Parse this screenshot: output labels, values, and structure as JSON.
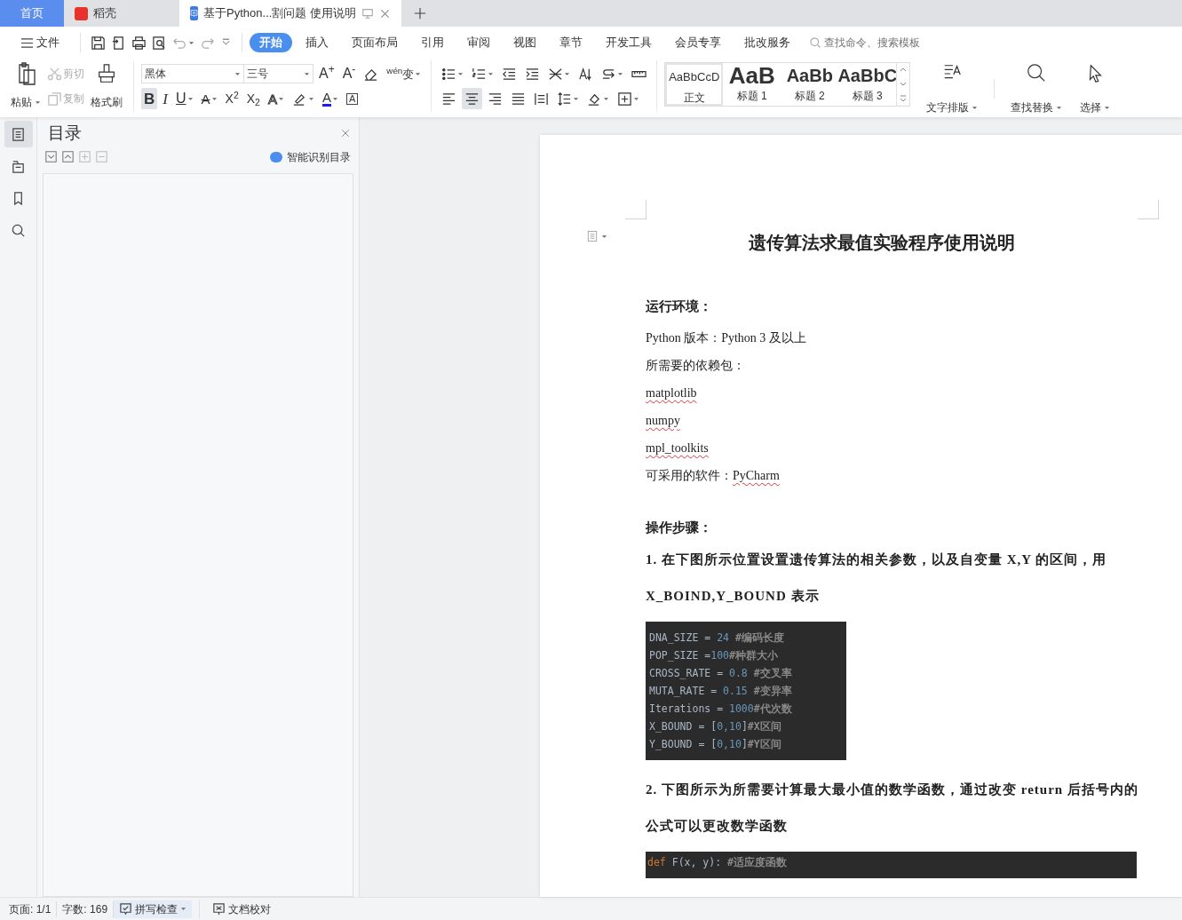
{
  "tabs": [
    {
      "label": "首页",
      "kind": "home",
      "selected": false
    },
    {
      "label": "稻壳",
      "kind": "app",
      "selected": false
    },
    {
      "label": "基于Python...割问题 使用说明",
      "kind": "doc",
      "selected": true
    }
  ],
  "menu": {
    "file": "文件",
    "ribbon_tabs": [
      {
        "label": "开始",
        "selected": true
      },
      {
        "label": "插入",
        "selected": false
      },
      {
        "label": "页面布局",
        "selected": false
      },
      {
        "label": "引用",
        "selected": false
      },
      {
        "label": "审阅",
        "selected": false
      },
      {
        "label": "视图",
        "selected": false
      },
      {
        "label": "章节",
        "selected": false
      },
      {
        "label": "开发工具",
        "selected": false
      },
      {
        "label": "会员专享",
        "selected": false
      },
      {
        "label": "批改服务",
        "selected": false
      }
    ],
    "search": {
      "placeholder": "查找命令、搜索模板"
    }
  },
  "clipboard": {
    "paste": "粘贴",
    "cut": {
      "label": "剪切",
      "disabled": true
    },
    "copy": {
      "label": "复制",
      "disabled": true
    },
    "format_painter": "格式刷"
  },
  "font": {
    "name": "黑体",
    "size": "三号",
    "row1": [
      {
        "kind": "grow",
        "glyph": "A$^{+}$",
        "selected": false
      },
      {
        "kind": "shrink",
        "glyph": "A$^{-}$",
        "selected": false
      },
      {
        "kind": "clear",
        "selected": false
      },
      {
        "kind": "phonetic",
        "glyph": "$^{wén}$变",
        "selected": false
      }
    ],
    "row2": [
      {
        "kind": "bold",
        "glyph": "B",
        "selected": true
      },
      {
        "kind": "italic",
        "glyph": "I",
        "selected": false
      },
      {
        "kind": "underline",
        "glyph": "U",
        "selected": false
      },
      {
        "kind": "strike",
        "glyph": "A",
        "selected": false
      },
      {
        "kind": "sup",
        "glyph": "X$^{2}$",
        "selected": false
      },
      {
        "kind": "sub",
        "glyph": "X$_{2}$",
        "selected": false
      },
      {
        "kind": "effect",
        "glyph": "A",
        "selected": false
      },
      {
        "kind": "highlight",
        "selected": false
      },
      {
        "kind": "color",
        "glyph": "A",
        "selected": false
      },
      {
        "kind": "boxed",
        "glyph": "A",
        "selected": false
      }
    ]
  },
  "paragraph": {
    "row1": [
      {
        "kind": "bullets",
        "selected": false
      },
      {
        "kind": "numbering",
        "selected": false
      },
      {
        "kind": "outdent",
        "selected": false
      },
      {
        "kind": "indent",
        "selected": false
      },
      {
        "kind": "layout",
        "selected": false
      },
      {
        "kind": "sort",
        "selected": false
      },
      {
        "kind": "breaks",
        "selected": false
      },
      {
        "kind": "ruler",
        "selected": false
      }
    ],
    "row2": [
      {
        "kind": "left",
        "selected": false
      },
      {
        "kind": "center",
        "selected": true
      },
      {
        "kind": "right",
        "selected": false
      },
      {
        "kind": "justify",
        "selected": false
      },
      {
        "kind": "distribute",
        "selected": false
      },
      {
        "kind": "spacing",
        "selected": false
      },
      {
        "kind": "shading",
        "selected": false
      },
      {
        "kind": "borders",
        "selected": false
      }
    ]
  },
  "styles": [
    {
      "preview": "AaBbCcD",
      "label": "正文",
      "kind": "normal",
      "selected": true
    },
    {
      "preview": "AaB",
      "label": "标题 1",
      "kind": "h1",
      "selected": false
    },
    {
      "preview": "AaBb",
      "label": "标题 2",
      "kind": "h2",
      "selected": false
    },
    {
      "preview": "AaBbC",
      "label": "标题 3",
      "kind": "h3",
      "selected": false
    }
  ],
  "tools": [
    {
      "label": "文字排版",
      "kind": "layout"
    },
    {
      "label": "查找替换",
      "kind": "find"
    },
    {
      "label": "选择",
      "kind": "select"
    }
  ],
  "sidebar": {
    "items": [
      {
        "kind": "toc",
        "selected": true
      },
      {
        "kind": "chapters",
        "selected": false
      },
      {
        "kind": "bookmark",
        "selected": false
      },
      {
        "kind": "search",
        "selected": false
      }
    ]
  },
  "toc": {
    "title": "目录",
    "smart": "智能识别目录",
    "buttons": [
      {
        "kind": "expand",
        "disabled": false
      },
      {
        "kind": "collapse",
        "disabled": false
      },
      {
        "kind": "add",
        "disabled": true
      },
      {
        "kind": "remove",
        "disabled": true
      }
    ]
  },
  "document": {
    "title": "遗传算法求最值实验程序使用说明",
    "blocks": [
      {
        "kind": "heading",
        "text": "运行环境："
      },
      {
        "kind": "text",
        "text": "Python 版本：Python 3 及以上"
      },
      {
        "kind": "text",
        "text": "所需要的依赖包："
      },
      {
        "kind": "text",
        "flagged": "matplotlib"
      },
      {
        "kind": "text",
        "flagged": "numpy"
      },
      {
        "kind": "text",
        "flagged": "mpl_toolkits"
      },
      {
        "kind": "text",
        "text": "可采用的软件：",
        "flagged": "PyCharm"
      },
      {
        "kind": "gap"
      },
      {
        "kind": "heading",
        "text": "操作步骤："
      },
      {
        "kind": "step",
        "text": "1.  在下图所示位置设置遗传算法的相关参数，以及自变量 X,Y 的区间，用"
      },
      {
        "kind": "step",
        "text": "X_BOIND,Y_BOUND 表示"
      },
      {
        "kind": "code",
        "lines": [
          [
            {
              "kind": "plain",
              "text": "DNA_SIZE = "
            },
            {
              "kind": "number",
              "text": "24"
            },
            {
              "kind": "comment",
              "text": " #编码长度"
            }
          ],
          [
            {
              "kind": "plain",
              "text": "POP_SIZE ="
            },
            {
              "kind": "number",
              "text": "100"
            },
            {
              "kind": "comment",
              "text": "#种群大小"
            }
          ],
          [
            {
              "kind": "plain",
              "text": "CROSS_RATE = "
            },
            {
              "kind": "number",
              "text": "0.8"
            },
            {
              "kind": "comment",
              "text": " #交叉率"
            }
          ],
          [
            {
              "kind": "plain",
              "text": "MUTA_RATE = "
            },
            {
              "kind": "number",
              "text": "0.15"
            },
            {
              "kind": "comment",
              "text": " #变异率"
            }
          ],
          [
            {
              "kind": "plain",
              "text": "Iterations = "
            },
            {
              "kind": "number",
              "text": "1000"
            },
            {
              "kind": "comment",
              "text": "#代次数"
            }
          ],
          [
            {
              "kind": "plain",
              "text": "X_BOUND = ["
            },
            {
              "kind": "number",
              "text": "0,10"
            },
            {
              "kind": "plain",
              "text": "]"
            },
            {
              "kind": "comment",
              "text": "#X区间"
            }
          ],
          [
            {
              "kind": "plain",
              "text": "Y_BOUND = ["
            },
            {
              "kind": "number",
              "text": "0,10"
            },
            {
              "kind": "plain",
              "text": "]"
            },
            {
              "kind": "comment",
              "text": "#Y区间"
            }
          ]
        ]
      },
      {
        "kind": "step",
        "text": "2.  下图所示为所需要计算最大最小值的数学函数，通过改变 return 后括号内的"
      },
      {
        "kind": "step",
        "text": "公式可以更改数学函数"
      },
      {
        "kind": "code_wide",
        "lines": [
          [
            {
              "kind": "keyword",
              "text": "def"
            },
            {
              "kind": "plain",
              "text": " F(x, y): "
            },
            {
              "kind": "comment",
              "text": "#适应度函数"
            }
          ]
        ]
      }
    ]
  },
  "status_bar": {
    "page": "页面: 1/1",
    "words": "字数: 169",
    "spell": "拼写检查",
    "proof": "文档校对"
  }
}
